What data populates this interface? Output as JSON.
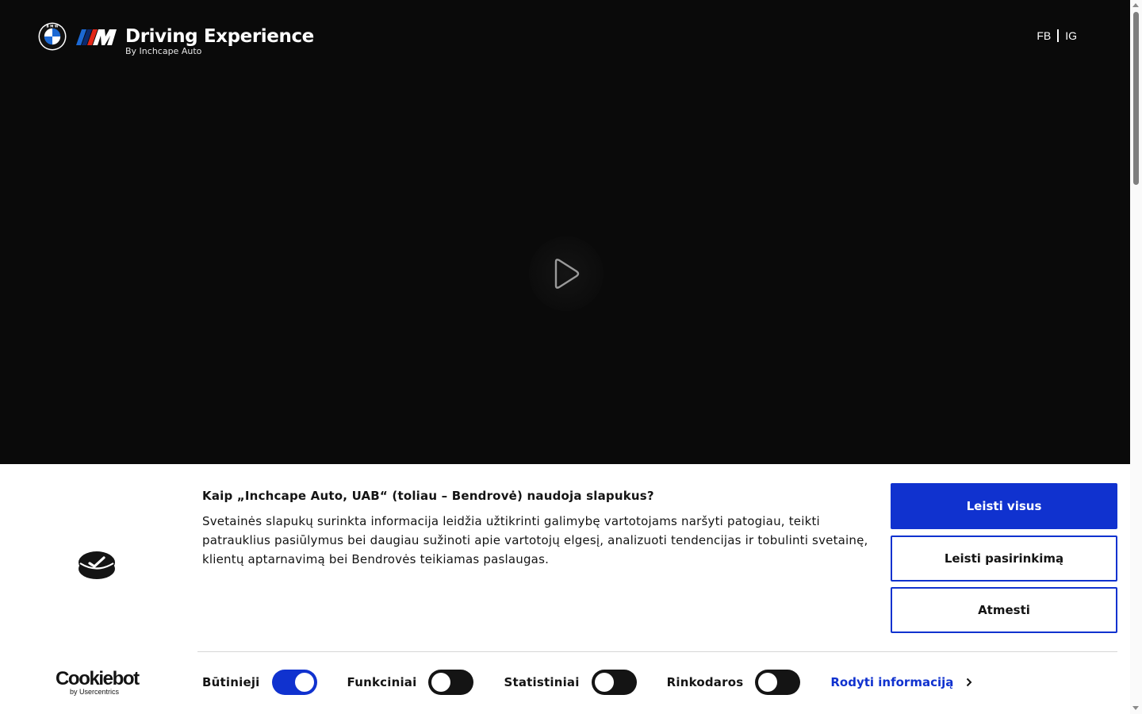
{
  "header": {
    "brand_title": "Driving Experience",
    "brand_subtitle": "By Inchcape Auto",
    "social": {
      "fb": "FB",
      "ig": "IG"
    }
  },
  "icons": {
    "bmw_logo": "bmw-roundel",
    "m_logo": "m-stripes",
    "play": "play-icon",
    "cookie_logo": "cookiebot-logo",
    "chevron": "chevron-right-icon"
  },
  "cookie_banner": {
    "brand_main": "Cookiebot",
    "brand_sub": "by Usercentrics",
    "title": "Kaip „Inchcape Auto, UAB“ (toliau – Bendrovė) naudoja slapukus?",
    "body": "Svetainės slapukų surinkta informacija leidžia užtikrinti galimybę vartotojams naršyti patogiau, teikti patrauklius pasiūlymus bei daugiau sužinoti apie vartotojų elgesį, analizuoti tendencijas ir tobulinti svetainę, klientų aptarnavimą bei Bendrovės teikiamas paslaugas.",
    "buttons": {
      "allow_all": "Leisti visus",
      "allow_selection": "Leisti pasirinkimą",
      "deny": "Atmesti"
    },
    "toggles": [
      {
        "label": "Būtinieji",
        "on": true
      },
      {
        "label": "Funkciniai",
        "on": false
      },
      {
        "label": "Statistiniai",
        "on": false
      },
      {
        "label": "Rinkodaros",
        "on": false
      }
    ],
    "details_link": "Rodyti informaciją"
  },
  "colors": {
    "accent": "#1032cf",
    "hero_background": "#0a0a0a",
    "banner_background": "#ffffff",
    "text": "#141414"
  }
}
